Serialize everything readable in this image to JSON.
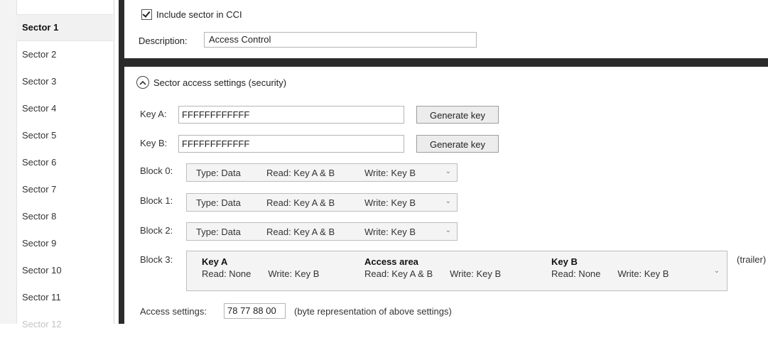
{
  "sidebar": {
    "items": [
      {
        "label": "Sector 1"
      },
      {
        "label": "Sector 2"
      },
      {
        "label": "Sector 3"
      },
      {
        "label": "Sector 4"
      },
      {
        "label": "Sector 5"
      },
      {
        "label": "Sector 6"
      },
      {
        "label": "Sector 7"
      },
      {
        "label": "Sector 8"
      },
      {
        "label": "Sector 9"
      },
      {
        "label": "Sector 10"
      },
      {
        "label": "Sector 11"
      },
      {
        "label": "Sector 12"
      }
    ],
    "selected_index": 0
  },
  "general": {
    "include_label": "Include sector in CCI",
    "include_checked": true,
    "description_label": "Description:",
    "description_value": "Access Control"
  },
  "access": {
    "section_title": "Sector access settings (security)",
    "key_a_label": "Key A:",
    "key_a_value": "FFFFFFFFFFFF",
    "key_b_label": "Key B:",
    "key_b_value": "FFFFFFFFFFFF",
    "generate_label": "Generate key",
    "blocks": [
      {
        "label": "Block 0:",
        "type": "Type: Data",
        "read": "Read: Key A & B",
        "write": "Write: Key B"
      },
      {
        "label": "Block 1:",
        "type": "Type: Data",
        "read": "Read: Key A & B",
        "write": "Write: Key B"
      },
      {
        "label": "Block 2:",
        "type": "Type: Data",
        "read": "Read: Key A & B",
        "write": "Write: Key B"
      }
    ],
    "block3": {
      "label": "Block 3:",
      "key_a": {
        "title": "Key A",
        "read": "Read: None",
        "write": "Write: Key B"
      },
      "access_area": {
        "title": "Access area",
        "read": "Read: Key A & B",
        "write": "Write: Key B"
      },
      "key_b": {
        "title": "Key B",
        "read": "Read: None",
        "write": "Write: Key B"
      },
      "suffix": "(trailer)"
    },
    "access_settings_label": "Access settings:",
    "access_settings_value": "78 77 88 00",
    "access_settings_note": "(byte representation of above settings)"
  }
}
